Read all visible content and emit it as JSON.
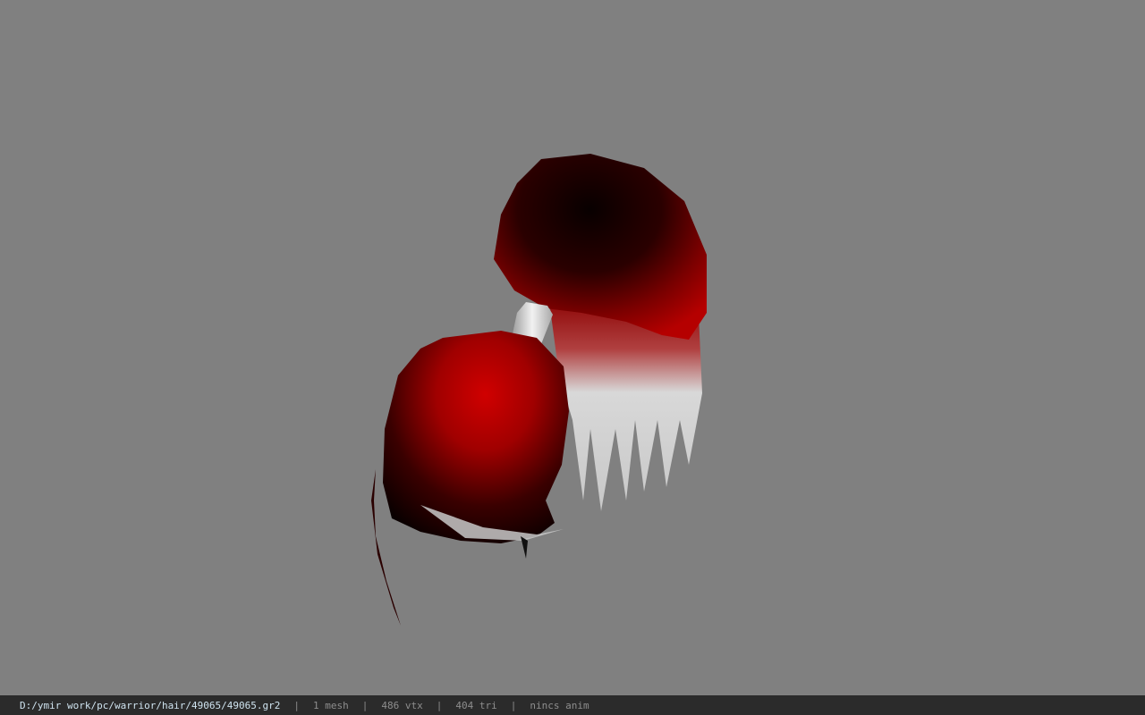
{
  "viewer": {
    "background_color": "#808080",
    "model_name": "hair"
  },
  "status_bar": {
    "file_path": "D:/ymir work/pc/warrior/hair/49065/49065.gr2",
    "separator": "|",
    "mesh_count": "1 mesh",
    "vertex_count": "486 vtx",
    "triangle_count": "404 tri",
    "animation": "nincs anim"
  },
  "colors": {
    "hair_dark": "#1a0000",
    "hair_red": "#b00000",
    "hair_tip": "#d8d8d8",
    "tie_band": "#e0e0e0",
    "status_bg": "#2b2b2b",
    "path_text": "#cfe3ef"
  }
}
